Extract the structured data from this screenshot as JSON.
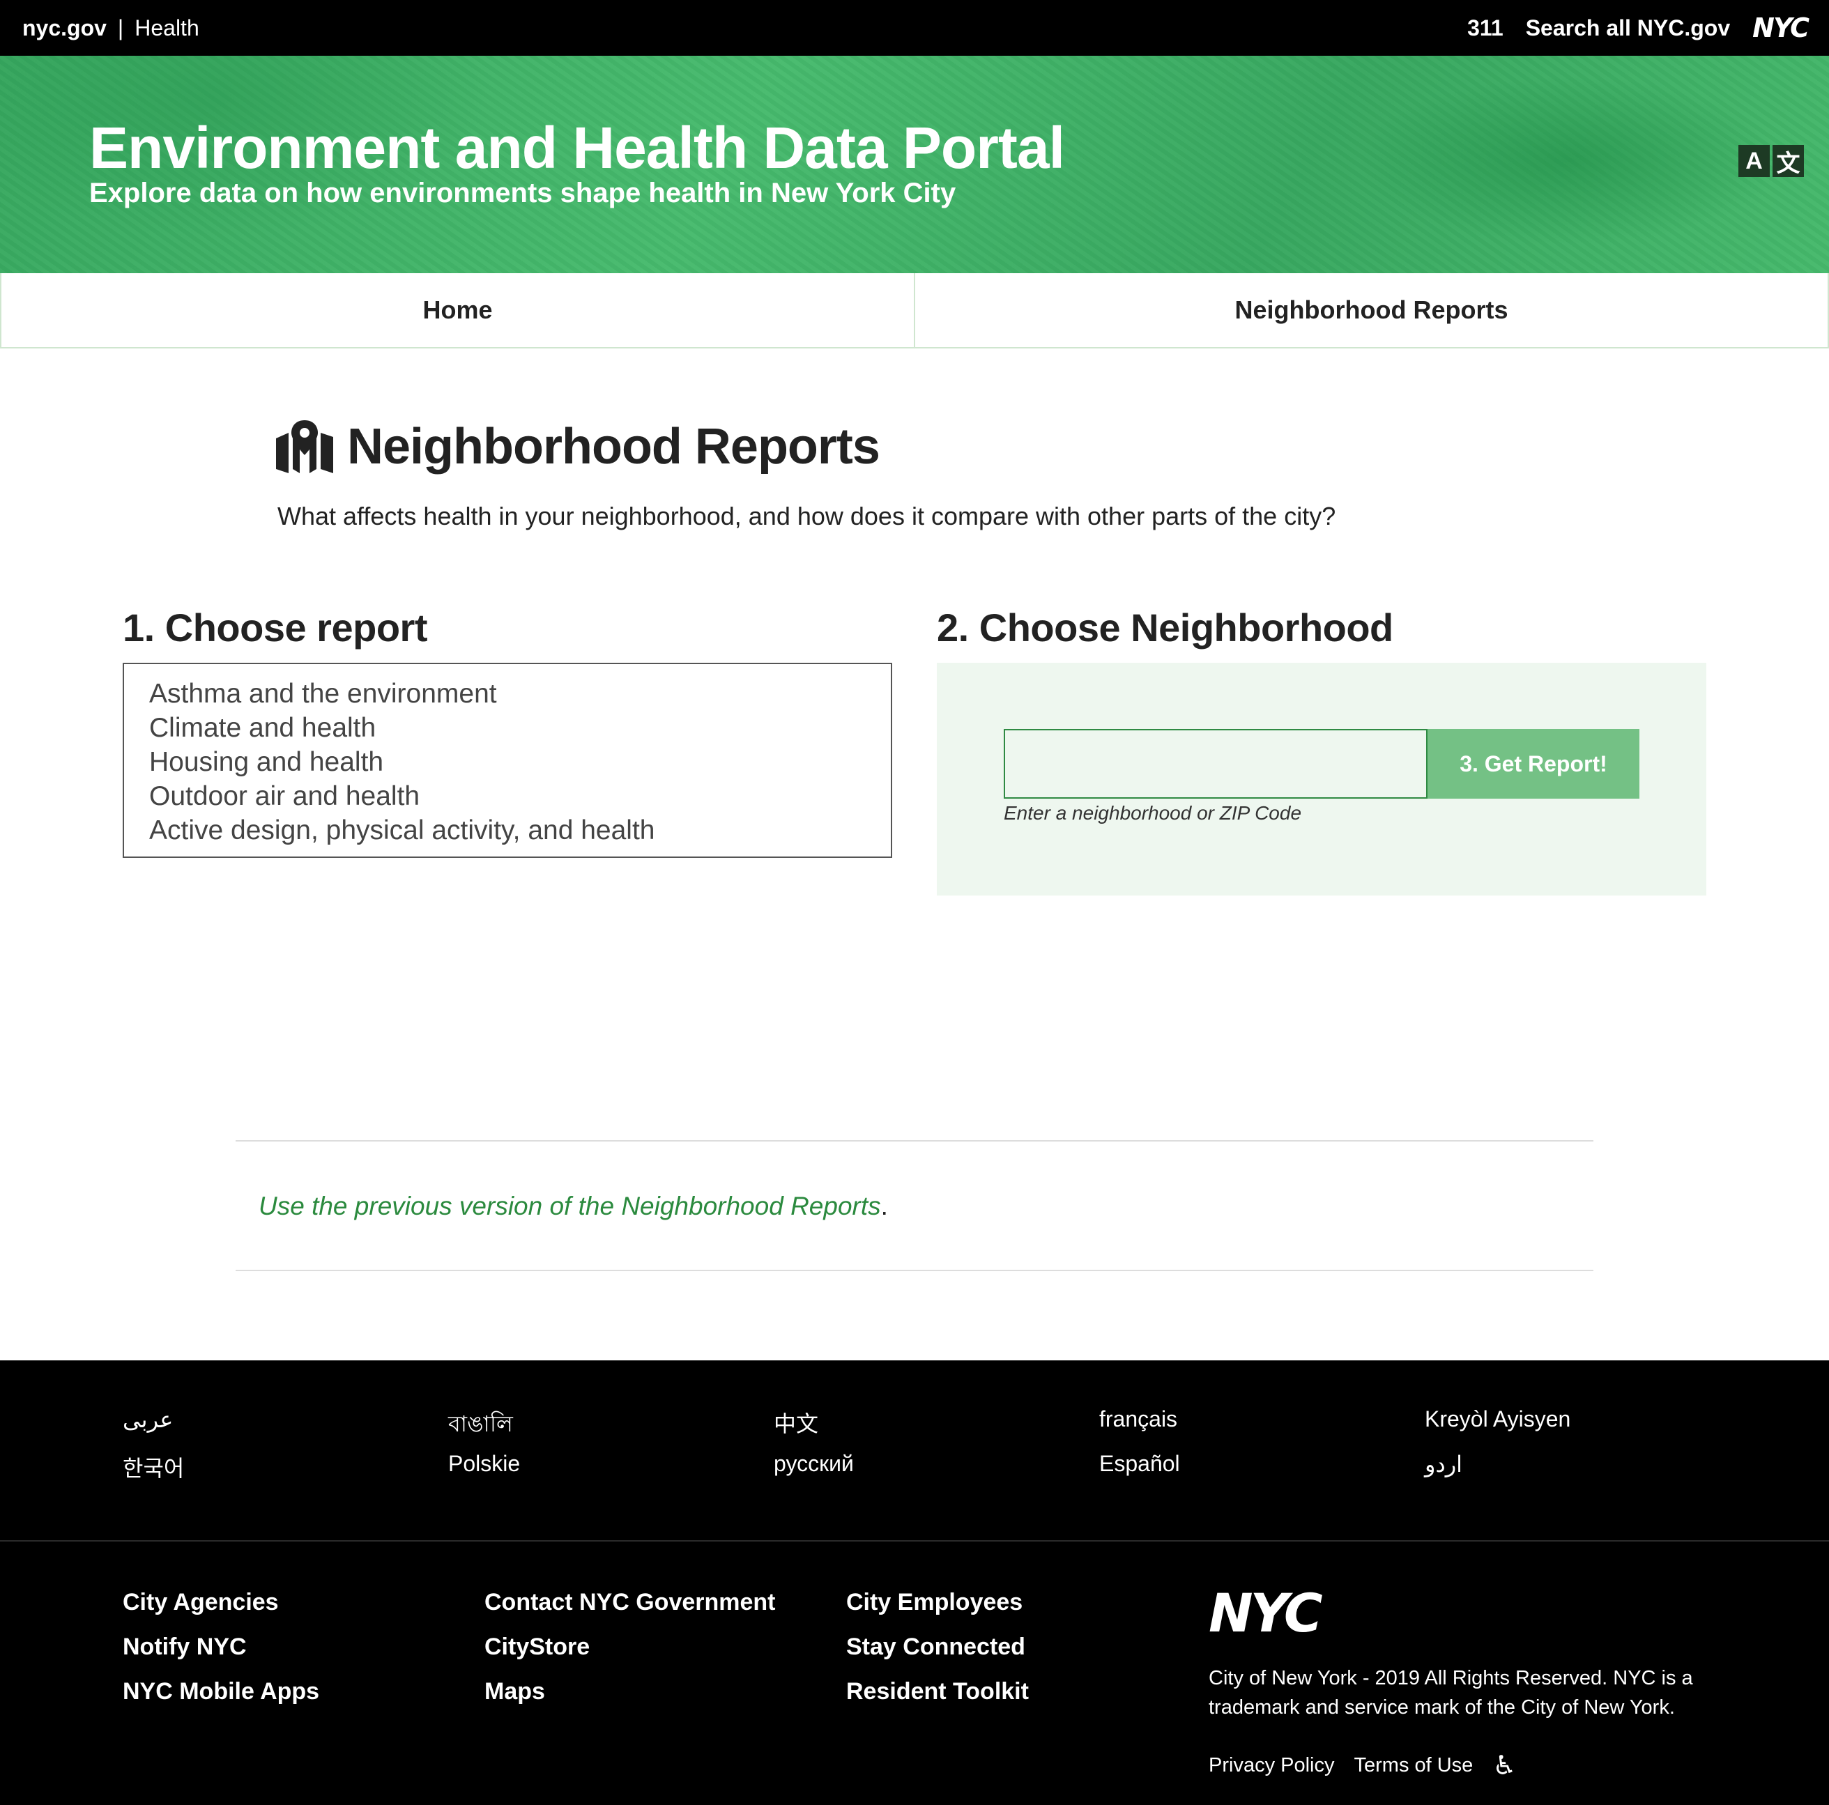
{
  "topbar": {
    "brand": "nyc.gov",
    "separator": "|",
    "section": "Health",
    "link_311": "311",
    "search_label": "Search all NYC.gov",
    "logo_text": "NYC"
  },
  "banner": {
    "title": "Environment and Health Data Portal",
    "subtitle": "Explore data on how environments shape health in New York City",
    "translate_glyph_a": "A",
    "translate_glyph_b": "文"
  },
  "nav": {
    "tabs": [
      "Home",
      "Neighborhood Reports"
    ]
  },
  "page": {
    "title": "Neighborhood Reports",
    "intro": "What affects health in your neighborhood, and how does it compare with other parts of the city?",
    "step1_title": "1. Choose report",
    "reports": [
      "Asthma and the environment",
      "Climate and health",
      "Housing and health",
      "Outdoor air and health",
      "Active design, physical activity, and health"
    ],
    "step2_title": "2. Choose Neighborhood",
    "search_value": "",
    "get_report_label": "3. Get Report!",
    "search_hint": "Enter a neighborhood or ZIP Code",
    "previous_link": "Use the previous version of the Neighborhood Reports",
    "previous_link_end": "."
  },
  "footer": {
    "languages": [
      "عربى",
      "বাঙালি",
      "中文",
      "français",
      "Kreyòl Ayisyen",
      "한국어",
      "Polskie",
      "русский",
      "Español",
      "اردو"
    ],
    "links": [
      "City Agencies",
      "Contact NYC Government",
      "City Employees",
      "Notify NYC",
      "CityStore",
      "Stay Connected",
      "NYC Mobile Apps",
      "Maps",
      "Resident Toolkit"
    ],
    "logo_text": "NYC",
    "copyright": "City of New York - 2019 All Rights Reserved. NYC is a trademark and service mark of the City of New York.",
    "privacy": "Privacy Policy",
    "terms": "Terms of Use",
    "accessibility_icon": "accessibility-icon"
  },
  "colors": {
    "banner_green": "#43b86b",
    "accent_green": "#2b8a3e",
    "button_green": "#74c185",
    "panel_bg": "#eef7ef"
  }
}
